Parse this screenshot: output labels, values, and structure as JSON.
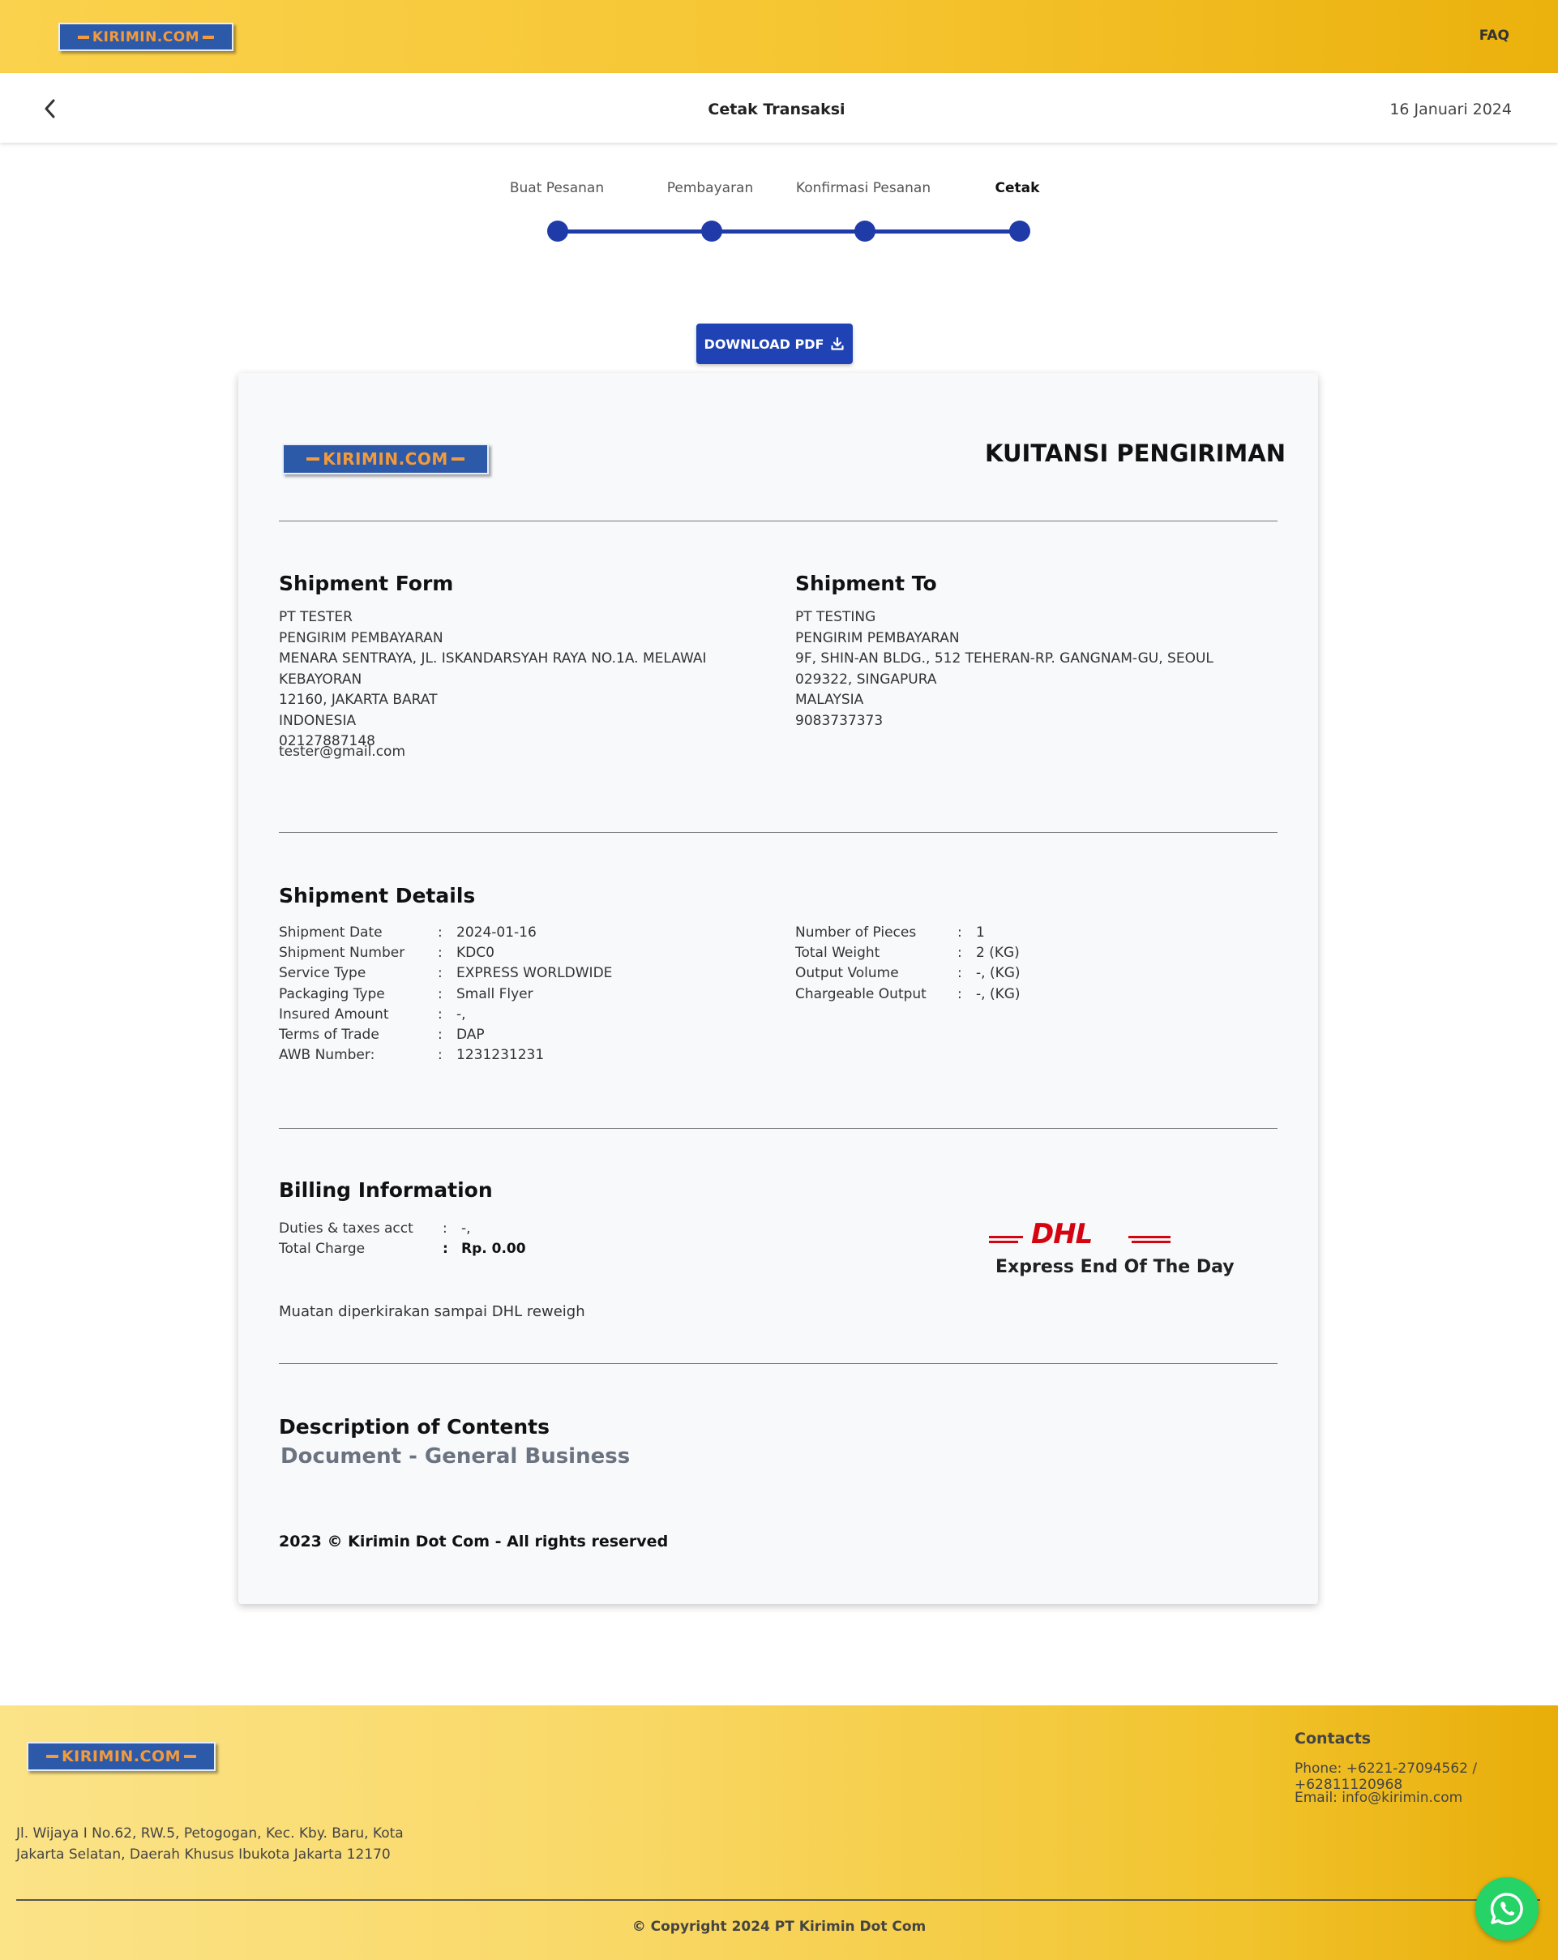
{
  "header": {
    "logo_text": "KIRIMIN.COM",
    "faq_label": "FAQ"
  },
  "subheader": {
    "back_icon": "chevron-left-icon",
    "title": "Cetak Transaksi",
    "date": "16 Januari 2024"
  },
  "stepper": {
    "steps": [
      {
        "label": "Buat Pesanan",
        "active": false
      },
      {
        "label": "Pembayaran",
        "active": false
      },
      {
        "label": "Konfirmasi Pesanan",
        "active": false
      },
      {
        "label": "Cetak",
        "active": true
      }
    ]
  },
  "download": {
    "label": "DOWNLOAD PDF",
    "icon": "download-icon"
  },
  "receipt": {
    "logo_text": "KIRIMIN.COM",
    "title": "KUITANSI PENGIRIMAN",
    "shipment_from": {
      "heading": "Shipment Form",
      "lines": [
        "PT TESTER",
        "PENGIRIM PEMBAYARAN",
        "MENARA SENTRAYA, JL. ISKANDARSYAH RAYA NO.1A. MELAWAI KEBAYORAN",
        "12160, JAKARTA BARAT",
        "INDONESIA",
        "02127887148"
      ],
      "email": "tester@gmail.com"
    },
    "shipment_to": {
      "heading": "Shipment To",
      "lines": [
        "PT TESTING",
        "PENGIRIM PEMBAYARAN",
        "9F, SHIN-AN BLDG., 512 TEHERAN-RP. GANGNAM-GU, SEOUL",
        "029322, SINGAPURA",
        "MALAYSIA",
        "9083737373"
      ]
    },
    "details": {
      "heading": "Shipment Details",
      "left": [
        {
          "label": "Shipment Date",
          "value": "2024-01-16"
        },
        {
          "label": "Shipment Number",
          "value": "KDC0"
        },
        {
          "label": "Service Type",
          "value": "EXPRESS WORLDWIDE"
        },
        {
          "label": "Packaging Type",
          "value": "Small Flyer"
        },
        {
          "label": "Insured Amount",
          "value": "-,"
        },
        {
          "label": "Terms of Trade",
          "value": "DAP"
        },
        {
          "label": "AWB Number:",
          "value": "1231231231"
        }
      ],
      "right": [
        {
          "label": "Number of Pieces",
          "value": "1"
        },
        {
          "label": "Total Weight",
          "value": "2 (KG)"
        },
        {
          "label": "Output Volume",
          "value": "-, (KG)"
        },
        {
          "label": "Chargeable Output",
          "value": "-, (KG)"
        }
      ]
    },
    "billing": {
      "heading": "Billing Information",
      "rows": [
        {
          "label": "Duties & taxes acct",
          "value": "-,"
        },
        {
          "label": "Total Charge",
          "value": "Rp. 0.00"
        }
      ],
      "note": "Muatan diperkirakan sampai DHL reweigh",
      "carrier_logo": "DHL",
      "service_name": "Express End Of The Day"
    },
    "contents": {
      "heading": "Description of Contents",
      "value": "Document - General Business"
    },
    "copyright": "2023 © Kirimin Dot Com - All rights reserved"
  },
  "footer": {
    "logo_text": "KIRIMIN.COM",
    "address_lines": [
      "Jl. Wijaya I No.62, RW.5, Petogogan, Kec. Kby. Baru, Kota",
      "Jakarta Selatan, Daerah Khusus Ibukota Jakarta 12170"
    ],
    "contacts_title": "Contacts",
    "phone": "Phone: +6221-27094562 / +62811120968",
    "email": "Email: info@kirimin.com",
    "copyright": "© Copyright 2024 PT Kirimin Dot Com"
  },
  "whatsapp_icon": "whatsapp-icon",
  "colors": {
    "accent_blue": "#1f3ba8",
    "brand_yellow": "#f5c430",
    "dhl_red": "#d40511",
    "whatsapp_green": "#25d366"
  }
}
